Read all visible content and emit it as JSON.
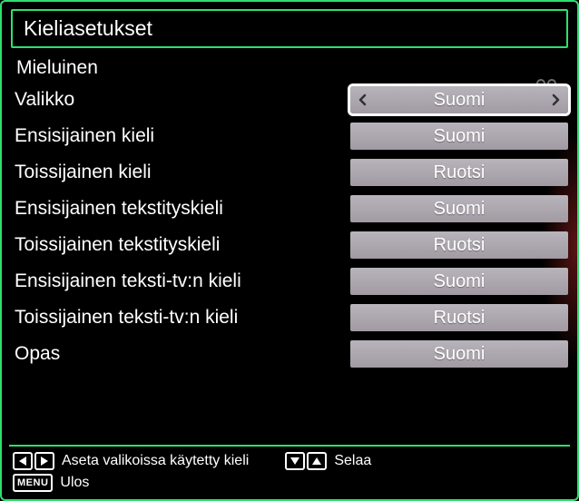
{
  "header": {
    "title": "Kieliasetukset"
  },
  "subheading": "Mieluinen",
  "rows": [
    {
      "label": "Valikko",
      "value": "Suomi",
      "selected": true
    },
    {
      "label": "Ensisijainen kieli",
      "value": "Suomi",
      "selected": false
    },
    {
      "label": "Toissijainen kieli",
      "value": "Ruotsi",
      "selected": false
    },
    {
      "label": "Ensisijainen tekstityskieli",
      "value": "Suomi",
      "selected": false
    },
    {
      "label": "Toissijainen tekstityskieli",
      "value": "Ruotsi",
      "selected": false
    },
    {
      "label": "Ensisijainen teksti-tv:n kieli",
      "value": "Suomi",
      "selected": false
    },
    {
      "label": "Toissijainen teksti-tv:n kieli",
      "value": "Ruotsi",
      "selected": false
    },
    {
      "label": "Opas",
      "value": "Suomi",
      "selected": false
    }
  ],
  "footer": {
    "hint_leftright": "Aseta valikoissa käytetty kieli",
    "hint_updown": "Selaa",
    "hint_menu_label": "MENU",
    "hint_menu": "Ulos"
  }
}
